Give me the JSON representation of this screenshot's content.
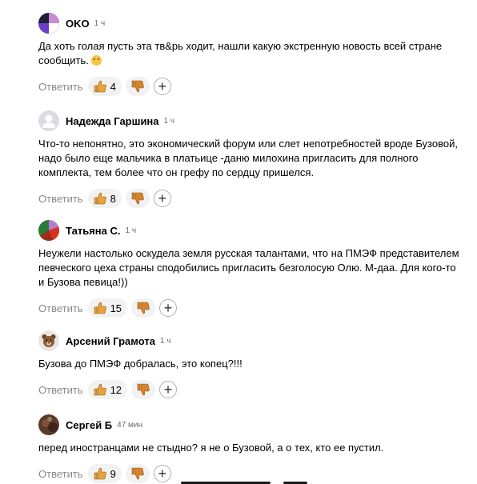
{
  "reply_label": "Ответить",
  "comments": [
    {
      "author": "OKO",
      "time": "1 ч",
      "text": "Да хоть голая пусть эта тв&рь ходит, нашли какую экстренную новость всей стране сообщить.",
      "likes": "4"
    },
    {
      "author": "Надежда Гаршина",
      "time": "1 ч",
      "text": "Что-то непонятно, это экономический форум или слет непотребностей вроде Бузовой, надо было еще мальчика в платьице -даню милохина пригласить для полного комплекта, тем более что он грефу по сердцу пришелся.",
      "likes": "8"
    },
    {
      "author": "Татьяна С.",
      "time": "1 ч",
      "text": "Неужели настолько оскудела земля русская талантами, что на ПМЭФ представителем певческого цеха страны сподобились пригласить безголосую Олю. М-даа. Для кого-то и Бузова певица!))",
      "likes": "15"
    },
    {
      "author": "Арсений Грамота",
      "time": "1 ч",
      "text": "Бузова до ПМЭФ добралась, это копец?!!!",
      "likes": "12"
    },
    {
      "author": "Сергей Б",
      "time": "47 мин",
      "text": "перед иностранцами не стыдно? я не о Бузовой, а о тех, кто ее пустил.",
      "likes": "9"
    }
  ],
  "colors": {
    "like": "#e8a33a",
    "dislike": "#d9822b"
  }
}
